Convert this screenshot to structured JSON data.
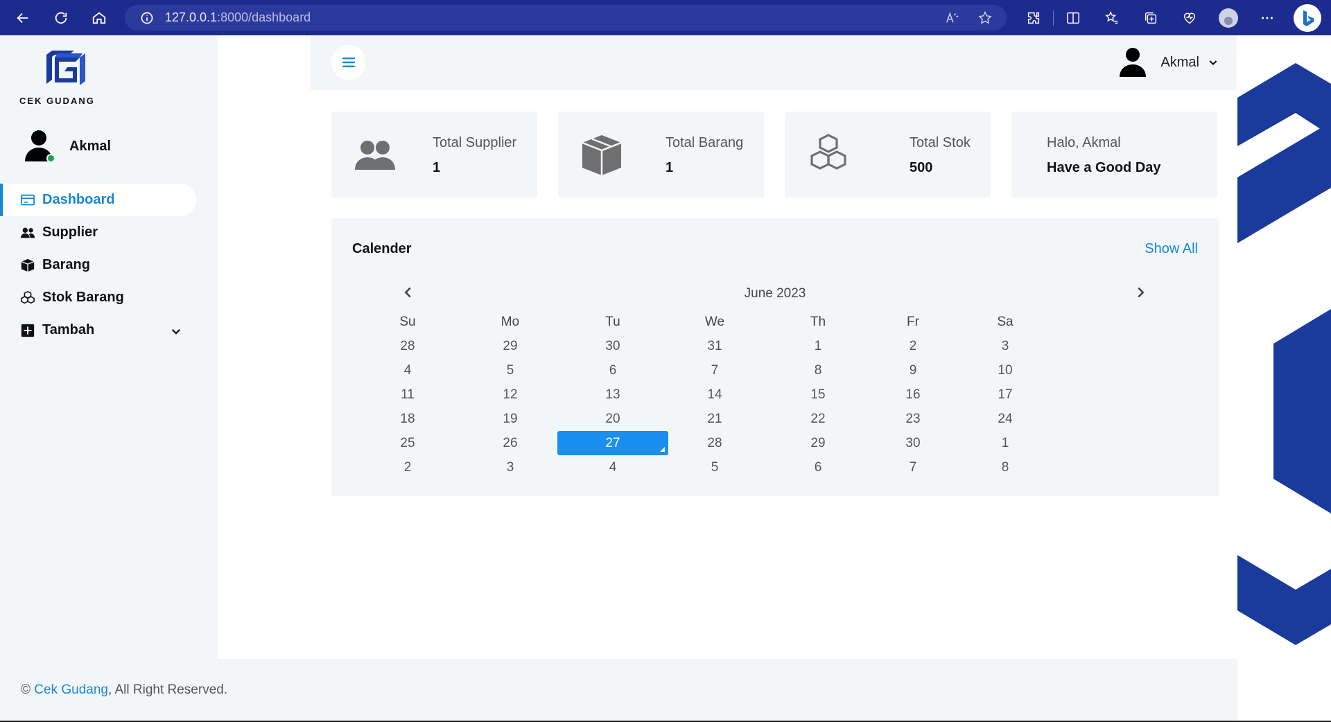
{
  "browser": {
    "url_host": "127.0.0.1",
    "url_path": ":8000/dashboard"
  },
  "sidebar": {
    "logo_text": "CEK GUDANG",
    "user_name": "Akmal",
    "items": [
      {
        "label": "Dashboard",
        "icon": "monitor-icon"
      },
      {
        "label": "Supplier",
        "icon": "users-icon"
      },
      {
        "label": "Barang",
        "icon": "box-icon"
      },
      {
        "label": "Stok Barang",
        "icon": "cubes-icon"
      },
      {
        "label": "Tambah",
        "icon": "plus-square-icon"
      }
    ]
  },
  "topbar": {
    "user_name": "Akmal"
  },
  "cards": [
    {
      "label": "Total Supplier",
      "value": "1",
      "icon": "users-icon"
    },
    {
      "label": "Total Barang",
      "value": "1",
      "icon": "box-icon"
    },
    {
      "label": "Total Stok",
      "value": "500",
      "icon": "cubes-icon"
    },
    {
      "label": "Halo, Akmal",
      "value": "Have a Good Day"
    }
  ],
  "calendar": {
    "title": "Calender",
    "show_all": "Show All",
    "month": "June 2023",
    "weekdays": [
      "Su",
      "Mo",
      "Tu",
      "We",
      "Th",
      "Fr",
      "Sa"
    ],
    "weeks": [
      [
        "28",
        "29",
        "30",
        "31",
        "1",
        "2",
        "3"
      ],
      [
        "4",
        "5",
        "6",
        "7",
        "8",
        "9",
        "10"
      ],
      [
        "11",
        "12",
        "13",
        "14",
        "15",
        "16",
        "17"
      ],
      [
        "18",
        "19",
        "20",
        "21",
        "22",
        "23",
        "24"
      ],
      [
        "25",
        "26",
        "27",
        "28",
        "29",
        "30",
        "1"
      ],
      [
        "2",
        "3",
        "4",
        "5",
        "6",
        "7",
        "8"
      ]
    ],
    "today": "27"
  },
  "footer": {
    "copyright": "©",
    "brand": "Cek Gudang",
    "rest": ", All Right Reserved."
  },
  "colors": {
    "accent": "#1589d8",
    "browser_bar": "#1d2b8e",
    "deco_blue": "#1a3a9c"
  }
}
